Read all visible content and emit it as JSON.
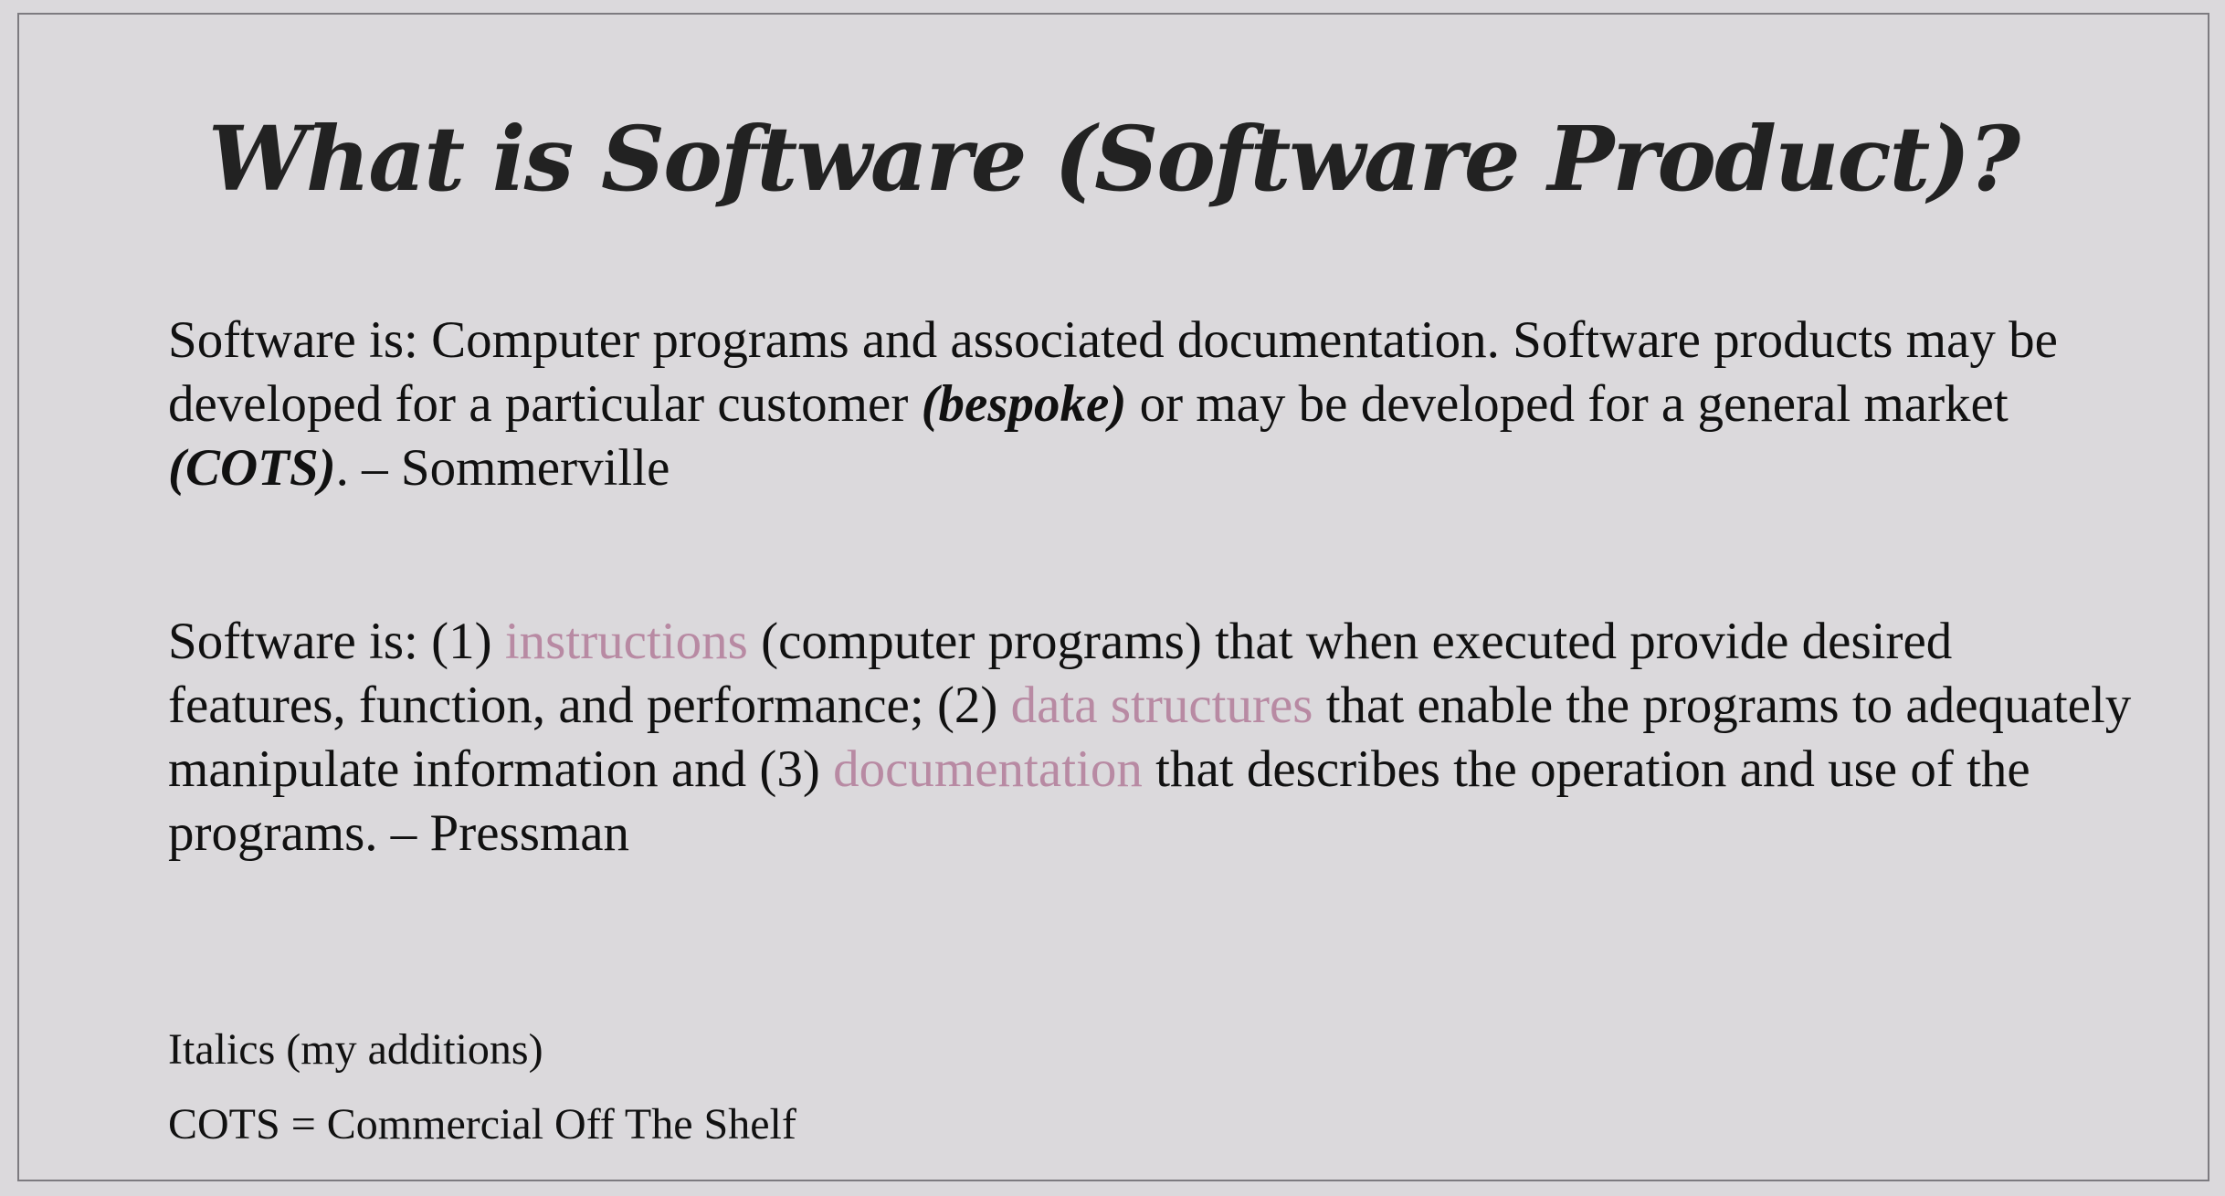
{
  "slide": {
    "title": "What is Software (Software Product)?",
    "paragraphs": [
      {
        "segments": [
          {
            "text": "Software is: Computer programs and associated documentation. Software products may be developed for a particular customer ",
            "style": "normal"
          },
          {
            "text": "(bespoke)",
            "style": "emphasis"
          },
          {
            "text": " or may be developed for a general market ",
            "style": "normal"
          },
          {
            "text": "(COTS)",
            "style": "emphasis"
          },
          {
            "text": ". – Sommerville",
            "style": "normal"
          }
        ]
      },
      {
        "segments": [
          {
            "text": "Software is: (1) ",
            "style": "normal"
          },
          {
            "text": "instructions",
            "style": "accent"
          },
          {
            "text": " (computer programs) that when executed provide desired features, function, and performance;  (2) ",
            "style": "normal"
          },
          {
            "text": "data structures",
            "style": "accent"
          },
          {
            "text": " that enable the programs to adequately manipulate information and (3) ",
            "style": "normal"
          },
          {
            "text": "documentation",
            "style": "accent"
          },
          {
            "text": " that describes the operation and use of the programs. – Pressman",
            "style": "normal"
          }
        ]
      }
    ],
    "notes": [
      "Italics (my additions)",
      "COTS = Commercial Off The Shelf"
    ]
  },
  "colors": {
    "background": "#dbd9dc",
    "text": "#111111",
    "accent": "#b88aa3",
    "border": "#7d7b80"
  }
}
